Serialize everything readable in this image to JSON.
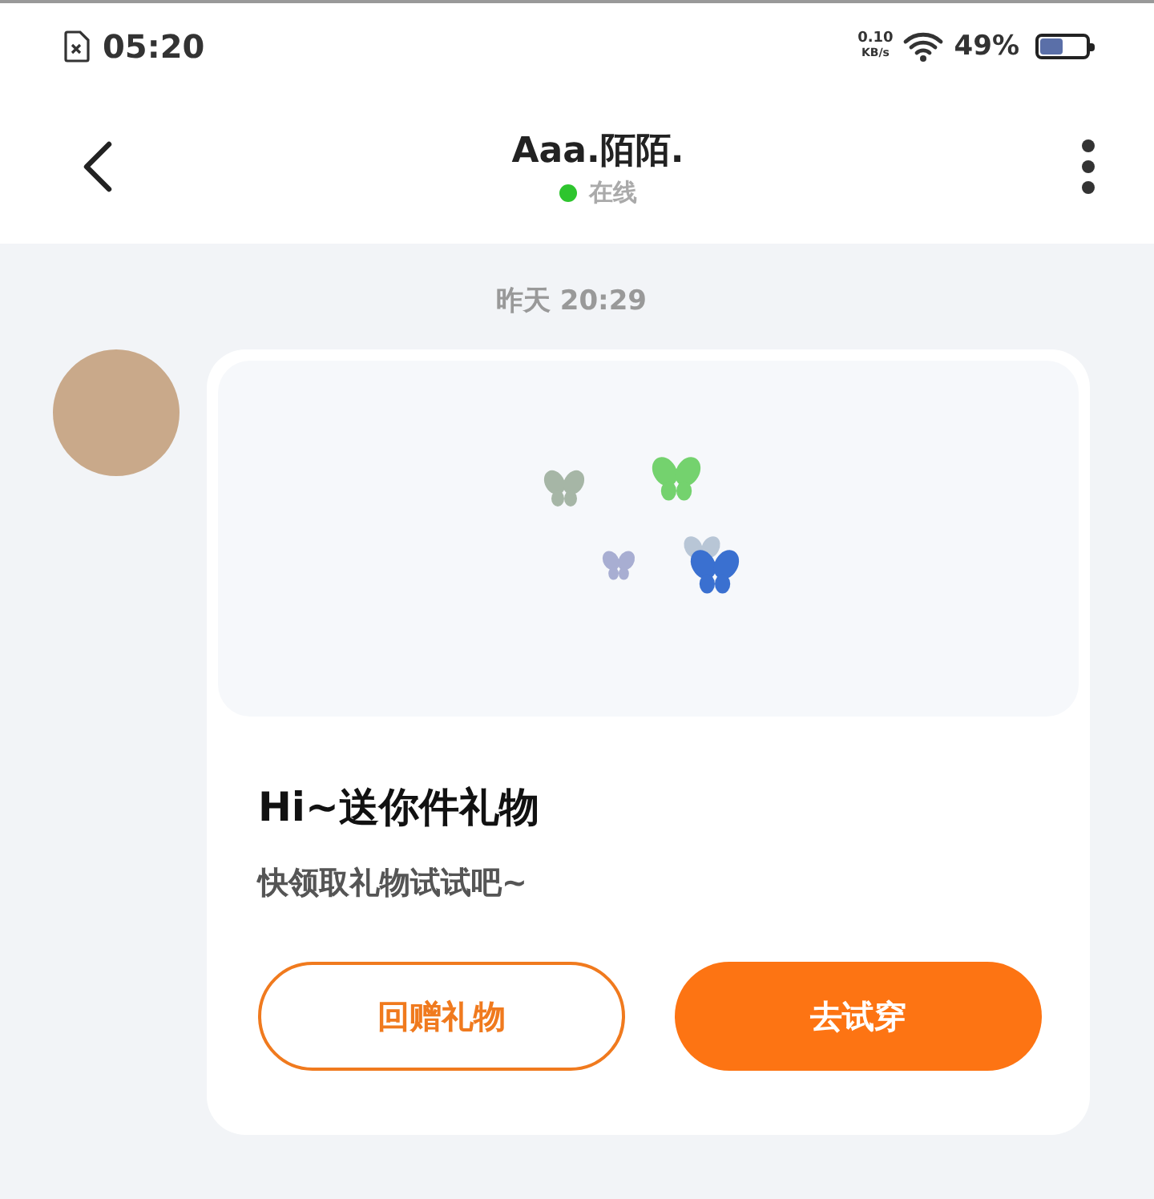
{
  "status_bar": {
    "time": "05:20",
    "net_speed": "0.10",
    "net_unit": "KB/s",
    "battery": "49%"
  },
  "header": {
    "title": "Aaa.陌陌.",
    "status": "在线",
    "online": true
  },
  "chat": {
    "timestamp": "昨天 20:29",
    "message": {
      "title": "Hi~送你件礼物",
      "subtitle": "快领取礼物试试吧~",
      "buttons": [
        {
          "label": "回赠礼物",
          "kind": "outline"
        },
        {
          "label": "去试穿",
          "kind": "filled"
        }
      ]
    }
  }
}
